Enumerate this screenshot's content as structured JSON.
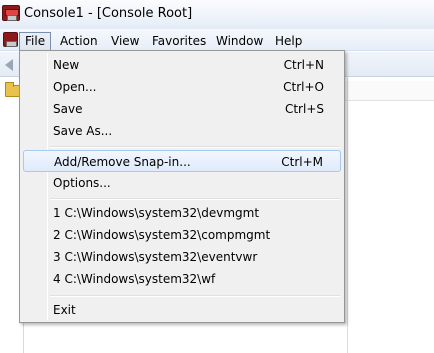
{
  "window": {
    "title": "Console1 - [Console Root]"
  },
  "menubar": {
    "items": [
      {
        "label": "File"
      },
      {
        "label": "Action"
      },
      {
        "label": "View"
      },
      {
        "label": "Favorites"
      },
      {
        "label": "Window"
      },
      {
        "label": "Help"
      }
    ]
  },
  "file_menu": {
    "new": {
      "label": "New",
      "shortcut": "Ctrl+N"
    },
    "open": {
      "label": "Open...",
      "shortcut": "Ctrl+O"
    },
    "save": {
      "label": "Save",
      "shortcut": "Ctrl+S"
    },
    "save_as": {
      "label": "Save As..."
    },
    "add_remove_snapin": {
      "label": "Add/Remove Snap-in...",
      "shortcut": "Ctrl+M"
    },
    "options": {
      "label": "Options..."
    },
    "recent": [
      {
        "label": "1 C:\\Windows\\system32\\devmgmt"
      },
      {
        "label": "2 C:\\Windows\\system32\\compmgmt"
      },
      {
        "label": "3 C:\\Windows\\system32\\eventvwr"
      },
      {
        "label": "4 C:\\Windows\\system32\\wf"
      }
    ],
    "exit": {
      "label": "Exit"
    }
  },
  "icons": {
    "app": "mmc-console-icon",
    "back": "back-arrow-icon",
    "folder": "folder-icon"
  },
  "colors": {
    "menu_background": "#f0f0f0",
    "highlight_border": "#a8c8ef",
    "titlebar": "#eef3fa"
  }
}
